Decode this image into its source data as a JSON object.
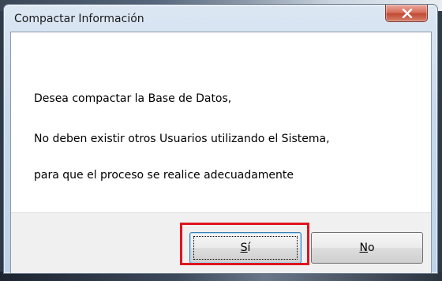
{
  "window": {
    "title": "Compactar Información"
  },
  "message": {
    "line1": "Desea compactar la Base de Datos,",
    "line2": "No deben existir otros Usuarios utilizando el Sistema,",
    "line3": "para que el proceso se realice adecuadamente"
  },
  "buttons": {
    "yes": {
      "mnemonic": "S",
      "rest": "í"
    },
    "no": {
      "mnemonic": "N",
      "rest": "o"
    }
  },
  "icons": {
    "close": "close-icon"
  },
  "colors": {
    "highlight": "#e0141e",
    "close_button": "#c14b35"
  }
}
